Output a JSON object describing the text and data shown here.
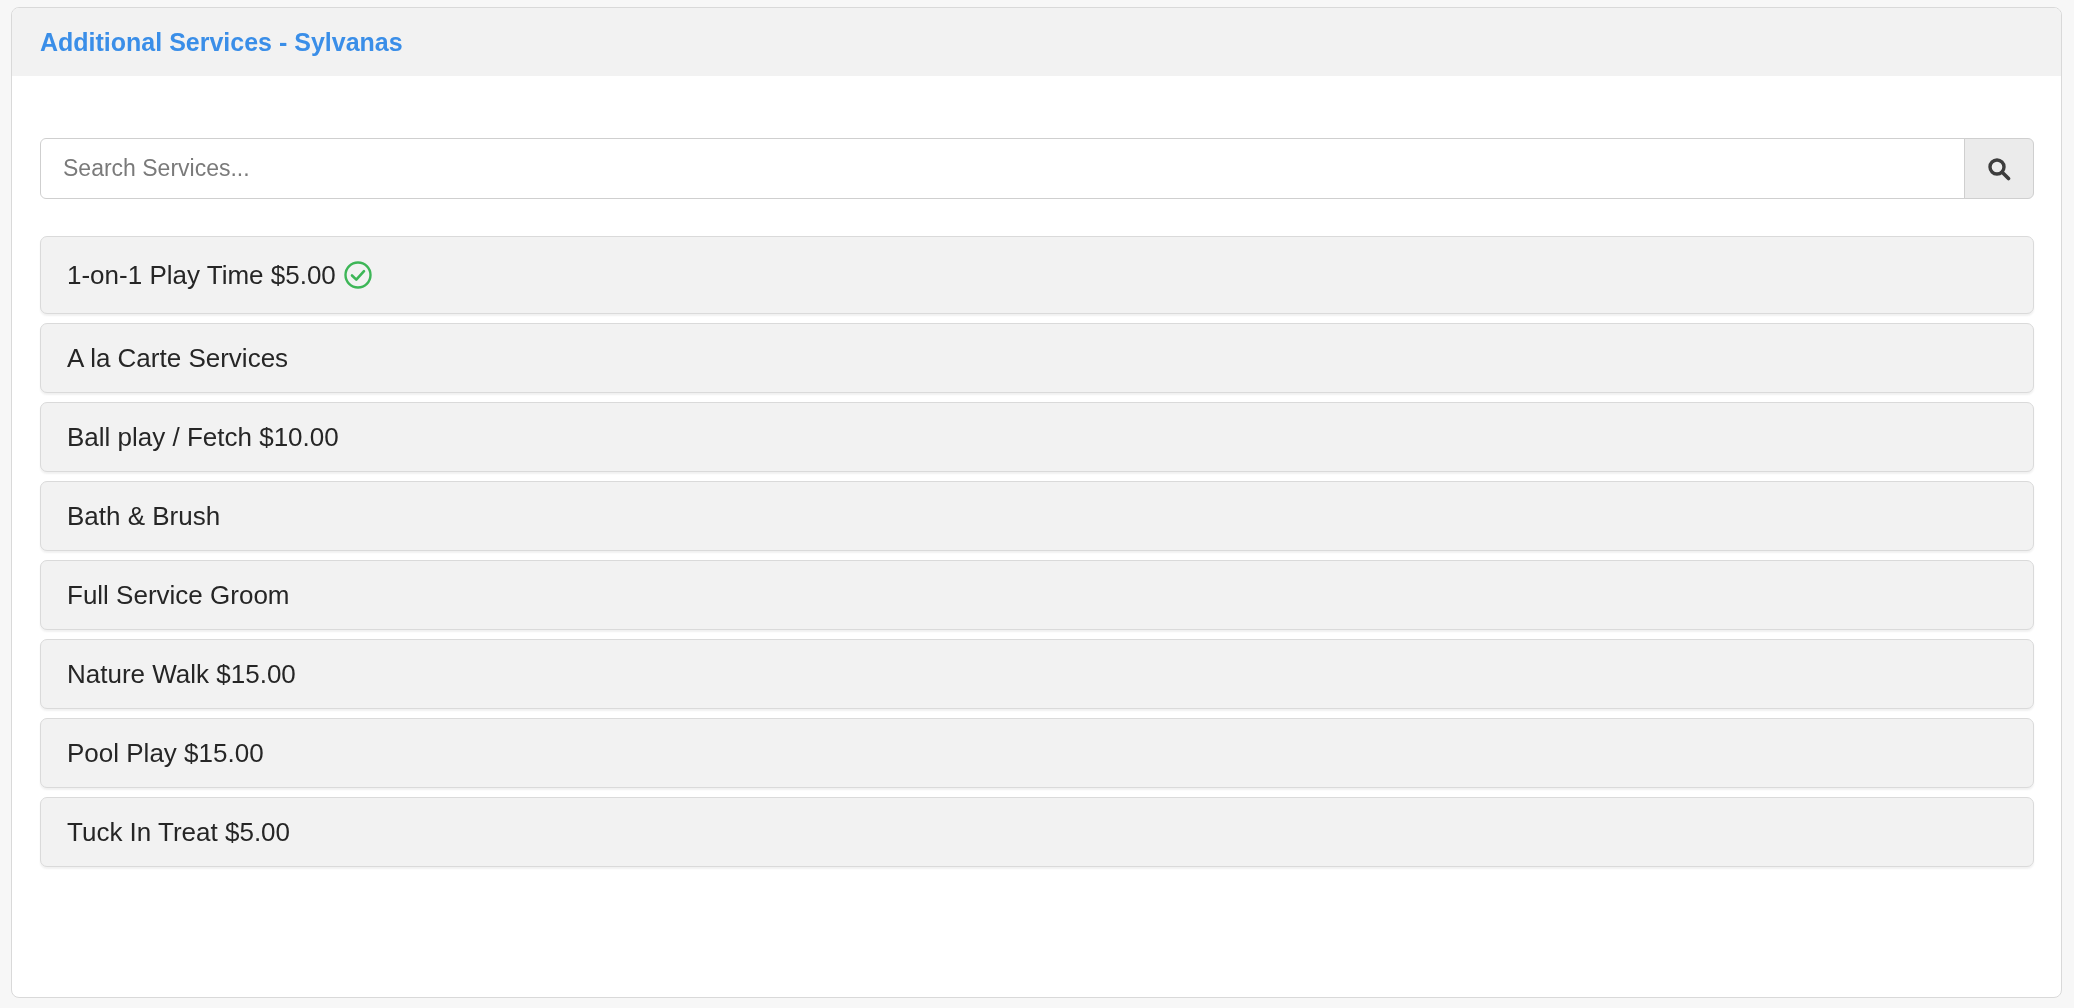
{
  "panel": {
    "title": "Additional Services - Sylvanas"
  },
  "search": {
    "placeholder": "Search Services..."
  },
  "services": [
    {
      "label": "1-on-1 Play Time $5.00",
      "selected": true
    },
    {
      "label": "A la Carte Services",
      "selected": false
    },
    {
      "label": "Ball play / Fetch $10.00",
      "selected": false
    },
    {
      "label": "Bath & Brush",
      "selected": false
    },
    {
      "label": "Full Service Groom",
      "selected": false
    },
    {
      "label": "Nature Walk $15.00",
      "selected": false
    },
    {
      "label": "Pool Play $15.00",
      "selected": false
    },
    {
      "label": "Tuck In Treat $5.00",
      "selected": false
    }
  ]
}
